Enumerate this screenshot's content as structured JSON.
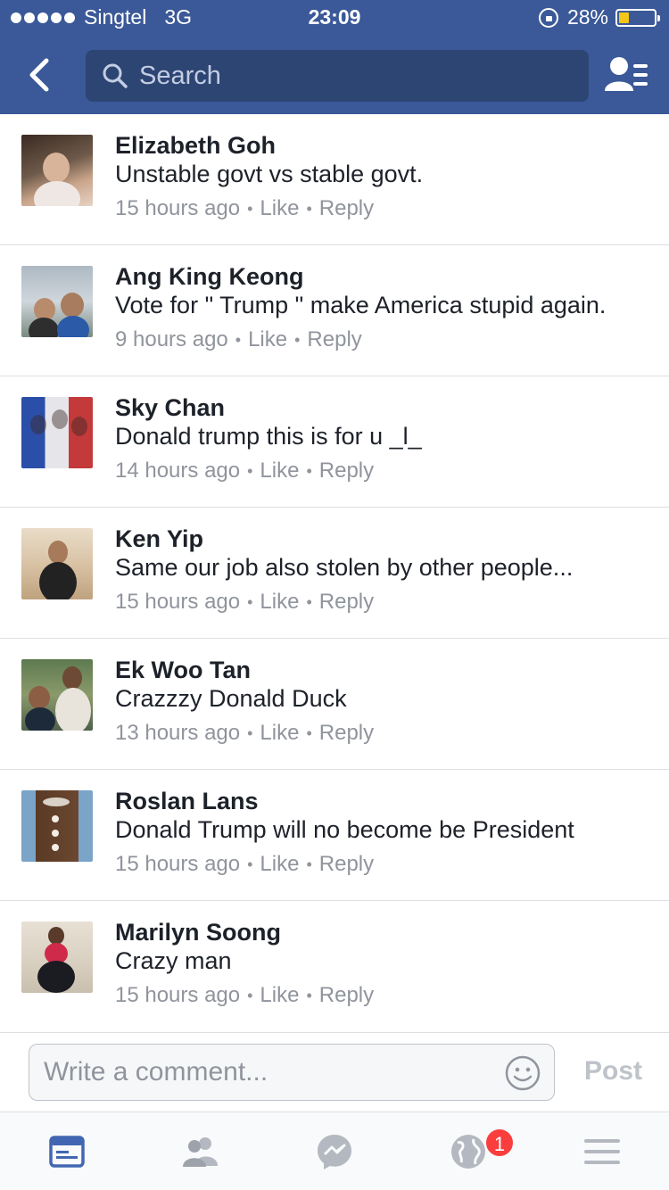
{
  "status_bar": {
    "carrier": "Singtel",
    "network": "3G",
    "time": "23:09",
    "battery": "28%",
    "battery_level": 0.28
  },
  "header": {
    "search_placeholder": "Search",
    "back_icon": "back-chevron-icon",
    "right_icon": "friend-requests-icon"
  },
  "comments": [
    {
      "name": "Elizabeth Goh",
      "text": "Unstable govt vs stable govt.",
      "time": "15 hours ago",
      "like": "Like",
      "reply": "Reply"
    },
    {
      "name": "Ang King Keong",
      "text": "Vote for \" Trump \" make America stupid again.",
      "time": "9 hours ago",
      "like": "Like",
      "reply": "Reply"
    },
    {
      "name": "Sky Chan",
      "text": "Donald trump this is for u _l_",
      "time": "14 hours ago",
      "like": "Like",
      "reply": "Reply"
    },
    {
      "name": "Ken Yip",
      "text": "Same our job also stolen by other people...",
      "time": "15 hours ago",
      "like": "Like",
      "reply": "Reply"
    },
    {
      "name": "Ek Woo Tan",
      "text": "Crazzzy Donald Duck",
      "time": "13 hours ago",
      "like": "Like",
      "reply": "Reply"
    },
    {
      "name": "Roslan Lans",
      "text": "Donald Trump will no become be President",
      "time": "15 hours ago",
      "like": "Like",
      "reply": "Reply"
    },
    {
      "name": "Marilyn Soong",
      "text": "Crazy man",
      "time": "15 hours ago",
      "like": "Like",
      "reply": "Reply"
    }
  ],
  "composer": {
    "placeholder": "Write a comment...",
    "post_label": "Post"
  },
  "tabbar": {
    "tabs": [
      "news-feed-icon",
      "friends-icon",
      "messenger-icon",
      "notifications-globe-icon",
      "menu-icon"
    ],
    "notifications_badge": "1"
  },
  "colors": {
    "brand_blue": "#3b5998",
    "search_bg": "#2d4573",
    "active_tab": "#4267b2",
    "badge_red": "#fa3e3e"
  }
}
